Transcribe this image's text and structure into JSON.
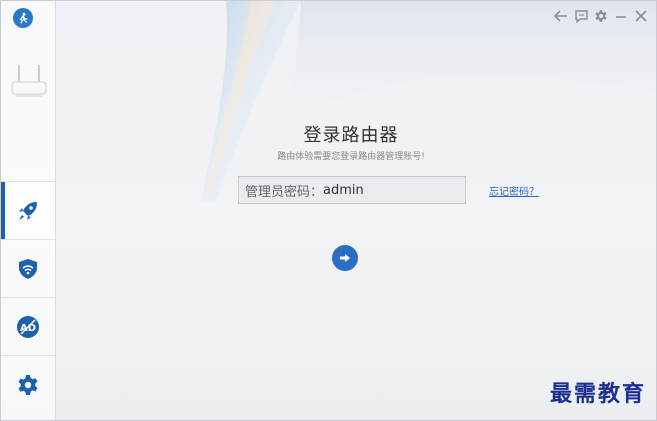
{
  "colors": {
    "accent": "#2a6fc3",
    "sidebar_active": "#1e5fae",
    "link": "#2a66c4"
  },
  "sidebar": {
    "items": [
      {
        "icon": "rocket-icon",
        "active": true
      },
      {
        "icon": "shield-wifi-icon",
        "active": false
      },
      {
        "icon": "ad-block-icon",
        "active": false
      },
      {
        "icon": "gear-icon",
        "active": false
      }
    ]
  },
  "window_controls": [
    "back-arrow-icon",
    "feedback-icon",
    "settings-icon",
    "minimize-icon",
    "close-icon"
  ],
  "login": {
    "title": "登录路由器",
    "subtitle": "路由体验需要您登录路由器管理账号!",
    "password_label": "管理员密码：",
    "password_value": "admin",
    "forgot_link": "忘记密码？"
  },
  "watermark": "最需教育"
}
